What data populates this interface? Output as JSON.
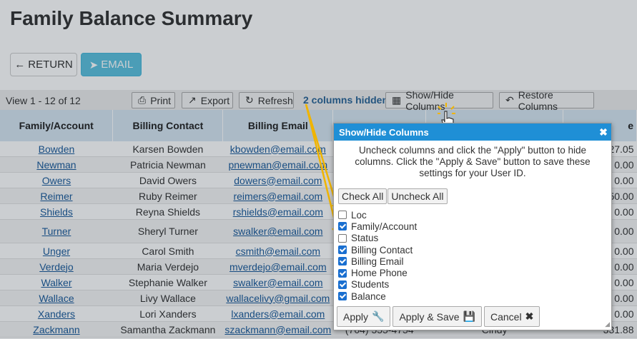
{
  "page": {
    "title": "Family Balance Summary"
  },
  "actions": {
    "return_label": "RETURN",
    "email_label": "EMAIL"
  },
  "toolbar": {
    "view_count": "View 1 - 12 of 12",
    "print_label": "Print",
    "export_label": "Export",
    "refresh_label": "Refresh",
    "hidden_note": "2 columns hidden",
    "showhide_label": "Show/Hide Columns",
    "restore_label": "Restore Columns"
  },
  "table": {
    "headers": [
      "Family/Account",
      "Billing Contact",
      "Billing Email",
      "",
      "",
      "e"
    ],
    "rows": [
      {
        "family": "Bowden",
        "contact": "Karsen Bowden",
        "email": "kbowden@email.com",
        "balance": "27.05"
      },
      {
        "family": "Newman",
        "contact": "Patricia Newman",
        "email": "pnewman@email.com",
        "balance": "0.00"
      },
      {
        "family": "Owers",
        "contact": "David Owers",
        "email": "dowers@email.com",
        "balance": "0.00"
      },
      {
        "family": "Reimer",
        "contact": "Ruby Reimer",
        "email": "reimers@email.com",
        "balance": "50.00"
      },
      {
        "family": "Shields",
        "contact": "Reyna Shields",
        "email": "rshields@email.com",
        "balance": "0.00"
      },
      {
        "family": "Turner",
        "contact": "Sheryl Turner",
        "email": "swalker@email.com",
        "balance": "0.00"
      },
      {
        "family": "Unger",
        "contact": "Carol Smith",
        "email": "csmith@email.com",
        "balance": "0.00"
      },
      {
        "family": "Verdejo",
        "contact": "Maria Verdejo",
        "email": "mverdejo@email.com",
        "balance": "0.00"
      },
      {
        "family": "Walker",
        "contact": "Stephanie Walker",
        "email": "swalker@email.com",
        "balance": "0.00"
      },
      {
        "family": "Wallace",
        "contact": "Livy Wallace",
        "email": "wallacelivy@gmail.com",
        "balance": "0.00"
      },
      {
        "family": "Xanders",
        "contact": "Lori Xanders",
        "email": "lxanders@email.com",
        "balance": "0.00"
      },
      {
        "family": "Zackmann",
        "contact": "Samantha Zackmann",
        "email": "szackmann@email.com",
        "balance": "331.88",
        "phone": "(704) 555-4754",
        "student": "Cindy"
      }
    ]
  },
  "dialog": {
    "title": "Show/Hide Columns",
    "close_label": "✖",
    "description": "Uncheck columns and click the \"Apply\" button to hide columns. Click the \"Apply & Save\" button to save these settings for your User ID.",
    "check_all_label": "Check All",
    "uncheck_all_label": "Uncheck All",
    "columns": [
      {
        "label": "Loc",
        "checked": false
      },
      {
        "label": "Family/Account",
        "checked": true
      },
      {
        "label": "Status",
        "checked": false
      },
      {
        "label": "Billing Contact",
        "checked": true
      },
      {
        "label": "Billing Email",
        "checked": true
      },
      {
        "label": "Home Phone",
        "checked": true
      },
      {
        "label": "Students",
        "checked": true
      },
      {
        "label": "Balance",
        "checked": true
      }
    ],
    "apply_label": "Apply",
    "apply_save_label": "Apply & Save",
    "cancel_label": "Cancel"
  },
  "colors": {
    "dialog_header": "#1f8fd6",
    "annotation_arrow": "#f0b400",
    "email_button": "#5bc0de",
    "header_row": "#d7e6f1"
  },
  "icons": [
    "arrow-left-icon",
    "paper-plane-icon",
    "print-icon",
    "export-icon",
    "refresh-icon",
    "grid-icon",
    "restore-icon",
    "close-icon",
    "wrench-icon",
    "save-icon",
    "x-icon",
    "hand-pointer-icon"
  ]
}
